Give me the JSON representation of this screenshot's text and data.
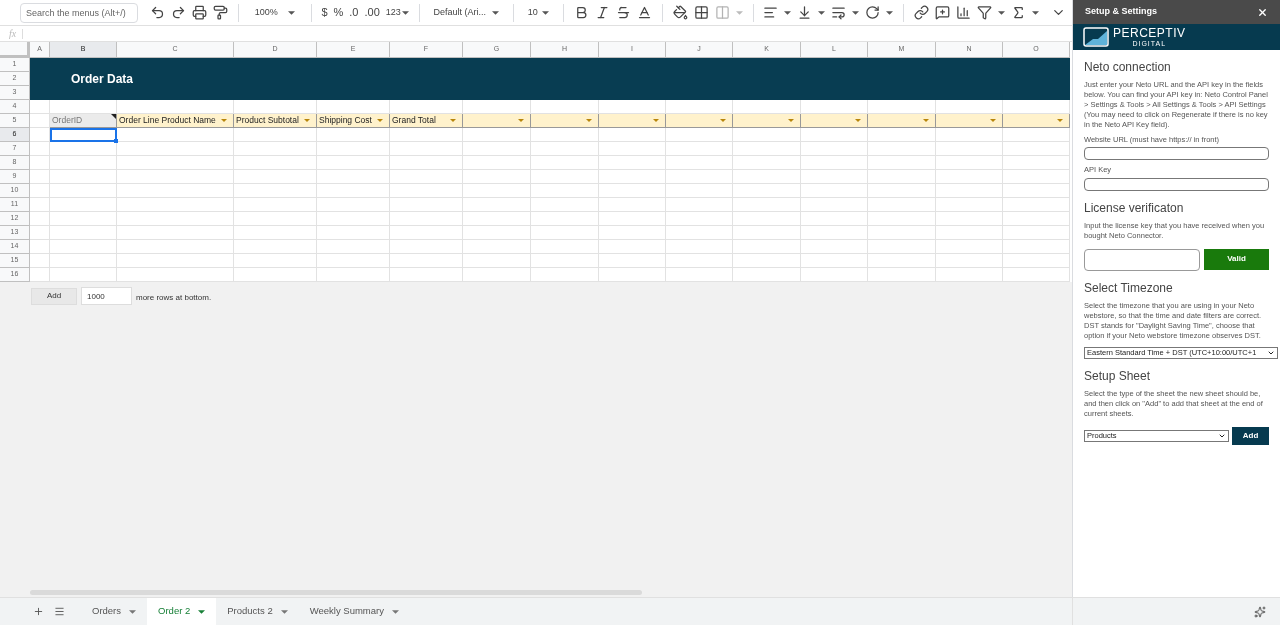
{
  "toolbar": {
    "search": {
      "placeholder": "Search the menus (Alt+/)"
    },
    "zoom": "100%",
    "currency": "$",
    "percent": "%",
    "decrease_decimal": ".0",
    "increase_decimal": ".00",
    "more_formats": "123",
    "font": "Default (Ari...",
    "font_size": "10"
  },
  "formula_bar": {
    "label": "fx"
  },
  "columns": [
    {
      "label": "A",
      "selected": false
    },
    {
      "label": "B",
      "selected": true
    },
    {
      "label": "C",
      "selected": false
    },
    {
      "label": "D",
      "selected": false
    },
    {
      "label": "E",
      "selected": false
    },
    {
      "label": "F",
      "selected": false
    },
    {
      "label": "G",
      "selected": false
    },
    {
      "label": "H",
      "selected": false
    },
    {
      "label": "I",
      "selected": false
    },
    {
      "label": "J",
      "selected": false
    },
    {
      "label": "K",
      "selected": false
    },
    {
      "label": "L",
      "selected": false
    },
    {
      "label": "M",
      "selected": false
    },
    {
      "label": "N",
      "selected": false
    },
    {
      "label": "O",
      "selected": false
    }
  ],
  "rows": [
    {
      "label": "1",
      "selected": false
    },
    {
      "label": "2",
      "selected": false
    },
    {
      "label": "3",
      "selected": false
    },
    {
      "label": "4",
      "selected": false
    },
    {
      "label": "5",
      "selected": false
    },
    {
      "label": "6",
      "selected": true
    },
    {
      "label": "7",
      "selected": false
    },
    {
      "label": "8",
      "selected": false
    },
    {
      "label": "9",
      "selected": false
    },
    {
      "label": "10",
      "selected": false
    },
    {
      "label": "11",
      "selected": false
    },
    {
      "label": "12",
      "selected": false
    },
    {
      "label": "13",
      "selected": false
    },
    {
      "label": "14",
      "selected": false
    },
    {
      "label": "15",
      "selected": false
    },
    {
      "label": "16",
      "selected": false
    }
  ],
  "banner": {
    "title": "Order Data"
  },
  "header_row": [
    {
      "text": "OrderID",
      "filter": false,
      "note": true
    },
    {
      "text": "Order Line Product Name",
      "filter": true,
      "note": false
    },
    {
      "text": "Product Subtotal",
      "filter": true,
      "note": false
    },
    {
      "text": "Shipping Cost",
      "filter": true,
      "note": false
    },
    {
      "text": "Grand Total",
      "filter": true,
      "note": false
    },
    {
      "filter": true,
      "note": false
    },
    {
      "filter": true,
      "note": false
    },
    {
      "filter": true,
      "note": false
    },
    {
      "filter": true,
      "note": false
    },
    {
      "filter": true,
      "note": false
    },
    {
      "filter": true,
      "note": false
    },
    {
      "filter": true,
      "note": false
    },
    {
      "filter": true,
      "note": false
    },
    {
      "filter": true,
      "note": false
    }
  ],
  "add_rows": {
    "button": "Add",
    "value": "1000",
    "suffix": "more rows at bottom."
  },
  "sheet_tabs": [
    {
      "label": "Orders",
      "selected": false
    },
    {
      "label": "Order 2",
      "selected": true
    },
    {
      "label": "Products 2",
      "selected": false
    },
    {
      "label": "Weekly Summary",
      "selected": false
    }
  ],
  "sidebar": {
    "title": "Setup & Settings",
    "logo": {
      "name": "PERCEPTIV",
      "sub": "DIGITAL"
    },
    "sections": [
      {
        "kind": "connection",
        "heading": "Neto connection",
        "text": "Just enter your Neto URL and the API key in the fields below. You can find your API key in: Neto Control Panel > Settings & Tools > All Settings & Tools > API Settings (You may need to click on Regenerate if there is no key in the Neto API Key field).",
        "fields": [
          {
            "label": "Website URL (must have https:// in front)"
          },
          {
            "label": "API Key"
          }
        ]
      },
      {
        "kind": "license",
        "heading": "License verificaton",
        "text": "Input the license key that you have received when you bought Neto Connector.",
        "button": "Valid"
      },
      {
        "kind": "timezone",
        "heading": "Select Timezone",
        "text": "Select the timezone that you are using in your Neto webstore, so that the time and date filters are correct. DST stands for \"Daylight Saving Time\", choose that option if your Neto webstore timezone observes DST.",
        "value": "Eastern Standard Time + DST (UTC+10:00/UTC+1"
      },
      {
        "kind": "sheet",
        "heading": "Setup Sheet",
        "text": "Select the type of the sheet the new sheet should be, and then click on \"Add\" to add that sheet at the end of current sheets.",
        "value": "Products",
        "button": "Add"
      }
    ]
  }
}
